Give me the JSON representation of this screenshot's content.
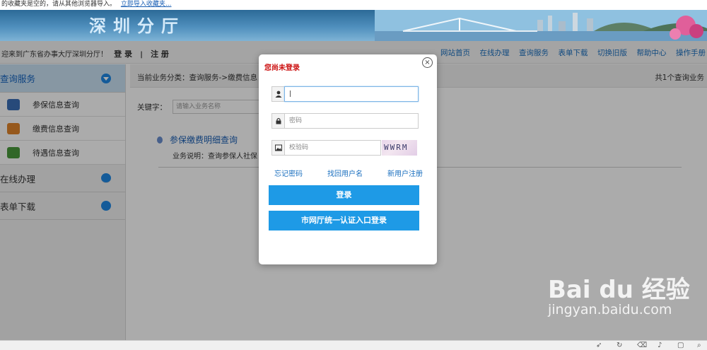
{
  "bookmark_bar": {
    "text": "的收藏夹是空的，请从其他浏览器导入。",
    "import_link": "立即导入收藏夹..."
  },
  "banner": {
    "title": "深圳分厅"
  },
  "topbar": {
    "welcome": "迎来到广东省办事大厅深圳分厅！",
    "login": "登 录",
    "separator": "|",
    "register": "注 册",
    "nav": [
      "网站首页",
      "在线办理",
      "查询服务",
      "表单下载",
      "切换旧版",
      "帮助中心",
      "操作手册"
    ]
  },
  "sidebar": {
    "sections": [
      {
        "label": "查询服务",
        "expanded": true,
        "items": [
          {
            "label": "参保信息查询",
            "icon": "people-icon",
            "color": "#3b6fb6"
          },
          {
            "label": "缴费信息查询",
            "icon": "wallet-icon",
            "color": "#e0832a"
          },
          {
            "label": "待遇信息查询",
            "icon": "money-icon",
            "color": "#4a9a3c"
          }
        ]
      },
      {
        "label": "在线办理",
        "expanded": false,
        "items": []
      },
      {
        "label": "表单下载",
        "expanded": false,
        "items": []
      }
    ]
  },
  "main": {
    "breadcrumb": "当前业务分类：查询服务->缴费信息",
    "count": "共1个查询业务",
    "keyword_label": "关键字：",
    "keyword_placeholder": "请输入业务名称",
    "result": {
      "title": "参保缴费明细查询",
      "desc": "业务说明：查询参保人社保"
    }
  },
  "modal": {
    "title": "您尚未登录",
    "close": "×",
    "username_value": "|",
    "password_placeholder": "密码",
    "captcha_placeholder": "校验码",
    "captcha_text": "WWRM",
    "links": [
      "忘记密码",
      "找回用户名",
      "新用户注册"
    ],
    "login_button": "登录",
    "unified_login_button": "市网厅统一认证入口登录"
  },
  "watermark": {
    "brand": "Bai du 经验",
    "url": "jingyan.baidu.com"
  },
  "colors": {
    "accent": "#1e9ae6",
    "title_red": "#cc1111",
    "link_blue": "#1a6fbf"
  }
}
